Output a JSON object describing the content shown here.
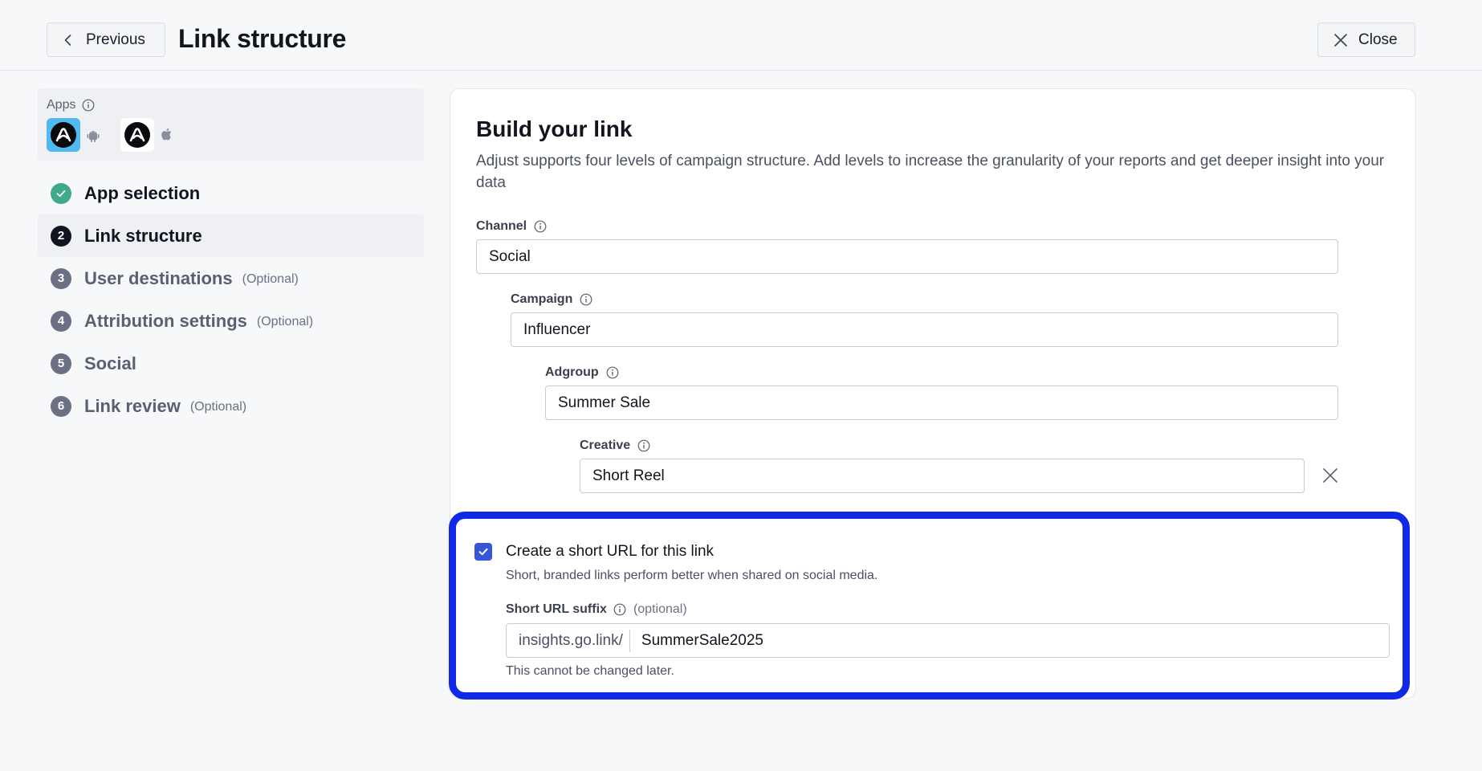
{
  "header": {
    "previous_label": "Previous",
    "title": "Link structure",
    "close_label": "Close"
  },
  "sidebar": {
    "apps_label": "Apps",
    "apps": [
      {
        "icon": "adjust-app-icon",
        "platform": "android"
      },
      {
        "icon": "adjust-app-icon",
        "platform": "ios"
      }
    ],
    "steps": [
      {
        "number": "",
        "label": "App selection",
        "optional": "",
        "state": "completed"
      },
      {
        "number": "2",
        "label": "Link structure",
        "optional": "",
        "state": "current"
      },
      {
        "number": "3",
        "label": "User destinations",
        "optional": "(Optional)",
        "state": "pending"
      },
      {
        "number": "4",
        "label": "Attribution settings",
        "optional": "(Optional)",
        "state": "pending"
      },
      {
        "number": "5",
        "label": "Social",
        "optional": "",
        "state": "pending"
      },
      {
        "number": "6",
        "label": "Link review",
        "optional": "(Optional)",
        "state": "pending"
      }
    ]
  },
  "main": {
    "title": "Build your link",
    "description": "Adjust supports four levels of campaign structure. Add levels to increase the granularity of your reports and get deeper insight into your data",
    "fields": {
      "channel": {
        "label": "Channel",
        "value": "Social"
      },
      "campaign": {
        "label": "Campaign",
        "value": "Influencer"
      },
      "adgroup": {
        "label": "Adgroup",
        "value": "Summer Sale"
      },
      "creative": {
        "label": "Creative",
        "value": "Short Reel"
      }
    },
    "short_url": {
      "checked": true,
      "checkbox_label": "Create a short URL for this link",
      "help": "Short, branded links perform better when shared on social media.",
      "suffix_label": "Short URL suffix",
      "suffix_optional": "(optional)",
      "prefix": "insights.go.link/",
      "value": "SummerSale2025",
      "note": "This cannot be changed later."
    }
  },
  "colors": {
    "accent": "#3656d9",
    "highlight": "#1029e6",
    "success": "#3fa98e"
  }
}
